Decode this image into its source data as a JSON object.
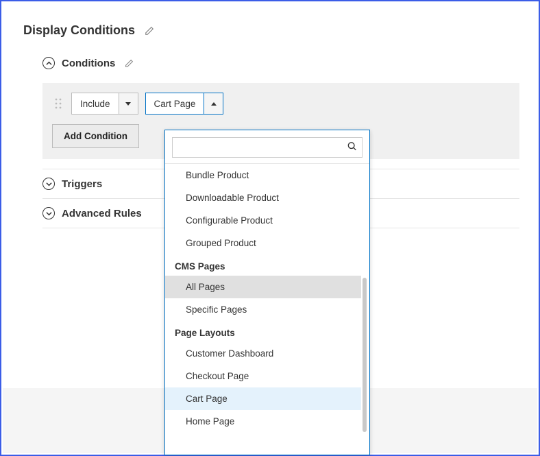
{
  "title": "Display Conditions",
  "sections": {
    "conditions": {
      "label": "Conditions",
      "expanded": true
    },
    "triggers": {
      "label": "Triggers",
      "expanded": false
    },
    "advanced": {
      "label": "Advanced Rules",
      "expanded": false
    }
  },
  "condition_row": {
    "include_label": "Include",
    "target_label": "Cart Page"
  },
  "buttons": {
    "add_condition": "Add Condition"
  },
  "dropdown": {
    "search_value": "",
    "items_top": [
      "Bundle Product",
      "Downloadable Product",
      "Configurable Product",
      "Grouped Product"
    ],
    "group_cms": "CMS Pages",
    "cms_pages": [
      "All Pages",
      "Specific Pages"
    ],
    "group_layouts": "Page Layouts",
    "layouts": [
      "Customer Dashboard",
      "Checkout Page",
      "Cart Page",
      "Home Page"
    ],
    "hovered": "All Pages",
    "selected": "Cart Page"
  }
}
